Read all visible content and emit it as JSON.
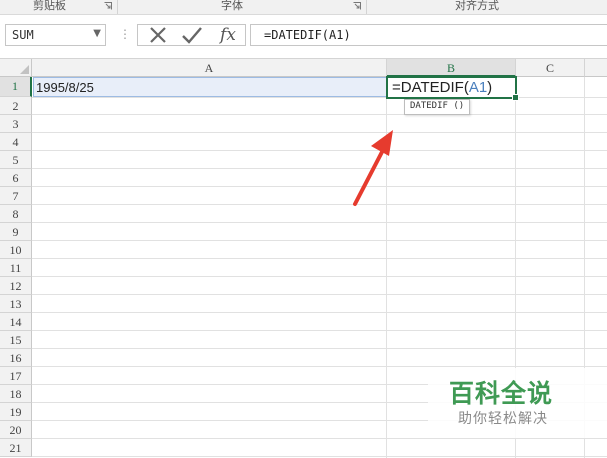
{
  "ribbon": {
    "groups": [
      {
        "label": "剪贴板"
      },
      {
        "label": "字体"
      },
      {
        "label": "对齐方式"
      }
    ]
  },
  "formula_bar": {
    "name_box": "SUM",
    "name_box_dropdown": "▼",
    "separator": "⋮",
    "cancel_icon": "close-icon",
    "enter_icon": "check-icon",
    "insert_function_label": "fx",
    "formula": "=DATEDIF(A1)"
  },
  "grid": {
    "columns": [
      "A",
      "B",
      "C"
    ],
    "selected_column": "B",
    "rows": [
      "1",
      "2",
      "3",
      "4",
      "5",
      "6",
      "7",
      "8",
      "9",
      "10",
      "11",
      "12",
      "13",
      "14",
      "15",
      "16",
      "17",
      "18",
      "19",
      "20",
      "21"
    ],
    "selected_row": "1",
    "cells": {
      "A1": "1995/8/25",
      "B1": {
        "prefix": "=DATEDIF(",
        "ref": "A1",
        "suffix": ")"
      }
    },
    "ref_color": "#4a7fbd",
    "active_border_color": "#217346"
  },
  "tooltip": {
    "text": "DATEDIF ()"
  },
  "annotation": {
    "arrow_color": "#e63b2e"
  },
  "watermark": {
    "title": "百科全说",
    "subtitle": "助你轻松解决",
    "title_color": "#3f9a54"
  }
}
